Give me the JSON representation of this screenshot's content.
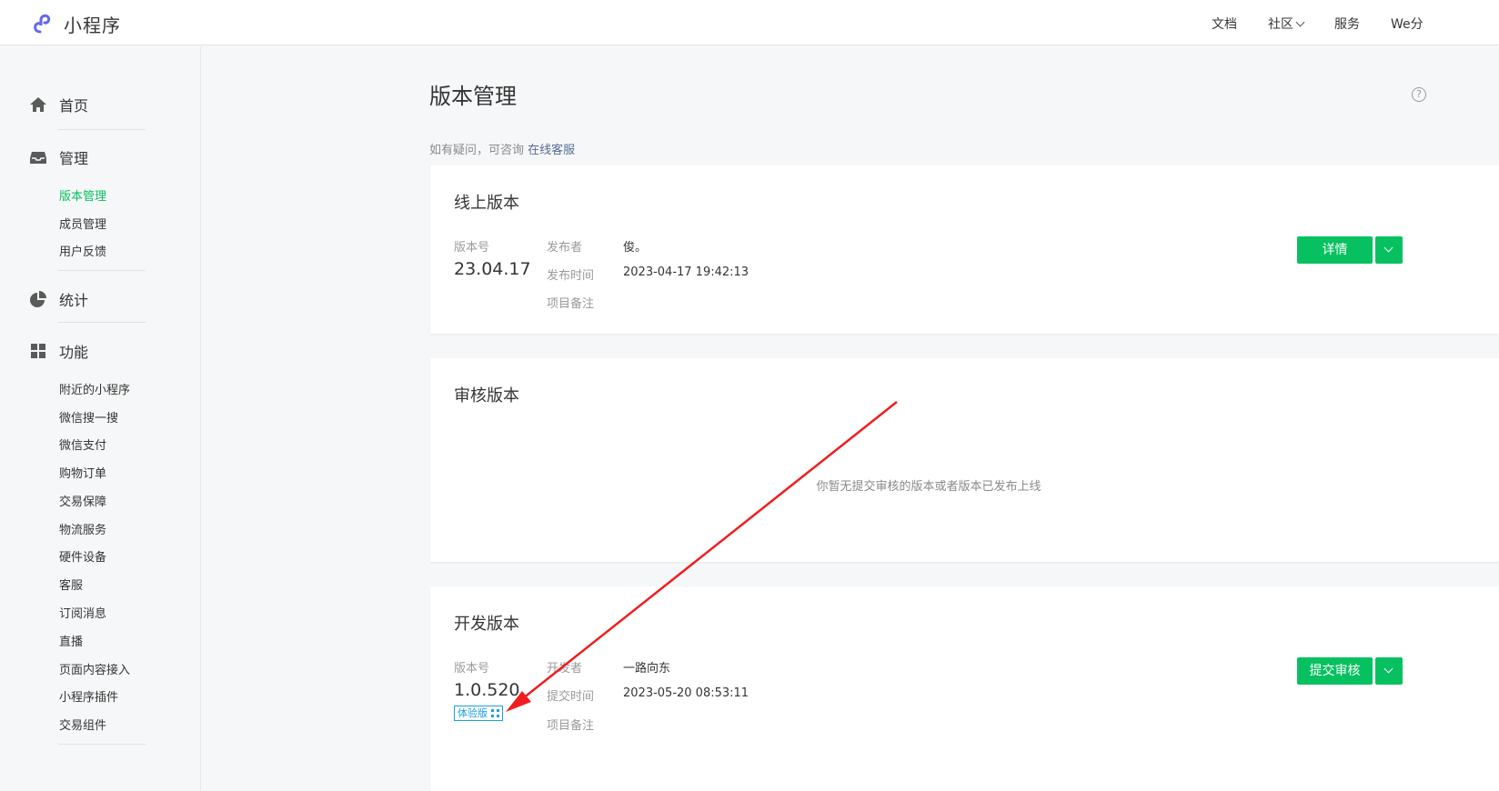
{
  "header": {
    "logo_text": "小程序",
    "nav": [
      "文档",
      "社区",
      "服务",
      "We分"
    ]
  },
  "sidebar": {
    "sections": [
      {
        "label": "首页",
        "icon": "home-icon"
      },
      {
        "label": "管理",
        "icon": "inbox-icon",
        "items": [
          "版本管理",
          "成员管理",
          "用户反馈"
        ]
      },
      {
        "label": "统计",
        "icon": "pie-chart-icon"
      },
      {
        "label": "功能",
        "icon": "grid-icon",
        "items": [
          "附近的小程序",
          "微信搜一搜",
          "微信支付",
          "购物订单",
          "交易保障",
          "物流服务",
          "硬件设备",
          "客服",
          "订阅消息",
          "直播",
          "页面内容接入",
          "小程序插件",
          "交易组件"
        ]
      }
    ],
    "active_item": "版本管理"
  },
  "main": {
    "title": "版本管理",
    "hint_text": "如有疑问，可咨询 ",
    "hint_link": "在线客服",
    "online": {
      "title": "线上版本",
      "version_label": "版本号",
      "version": "23.04.17",
      "publisher_label": "发布者",
      "publisher": "俊。",
      "time_label": "发布时间",
      "time": "2023-04-17 19:42:13",
      "note_label": "项目备注",
      "button": "详情"
    },
    "review": {
      "title": "审核版本",
      "empty_text": "你暂无提交审核的版本或者版本已发布上线"
    },
    "dev": {
      "title": "开发版本",
      "version_label": "版本号",
      "version": "1.0.520",
      "tag": "体验版",
      "developer_label": "开发者",
      "developer": "一路向东",
      "time_label": "提交时间",
      "time": "2023-05-20 08:53:11",
      "note_label": "项目备注",
      "button": "提交审核"
    },
    "help_glyph": "?"
  },
  "colors": {
    "accent": "#07c160",
    "link": "#576b95",
    "annotation_arrow": "#f01e1e"
  }
}
